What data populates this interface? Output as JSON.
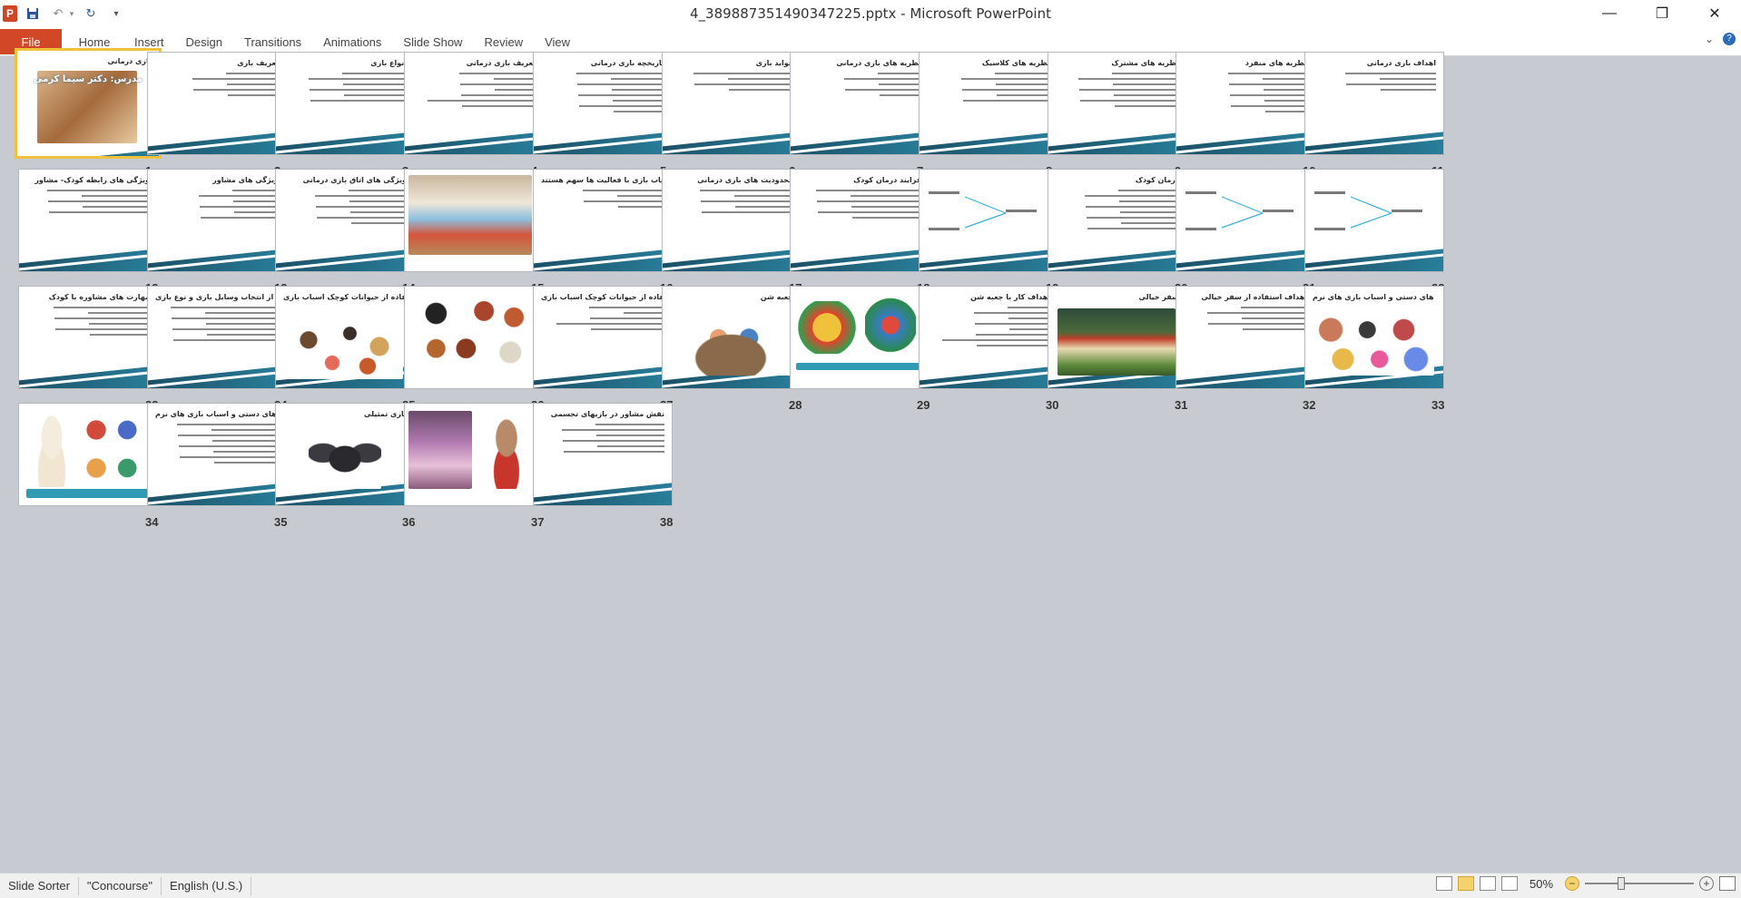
{
  "window": {
    "title": "4_389887351490347225.pptx  -  Microsoft PowerPoint",
    "app_icon_letter": "P",
    "controls": {
      "minimize": "—",
      "restore": "❐",
      "close": "✕"
    }
  },
  "quick_access": {
    "save_icon": "save-icon",
    "undo_icon": "undo-icon",
    "redo_icon": "redo-icon"
  },
  "ribbon": {
    "file_tab": "File",
    "tabs": [
      "Home",
      "Insert",
      "Design",
      "Transitions",
      "Animations",
      "Slide Show",
      "Review",
      "View"
    ]
  },
  "slides": [
    {
      "n": "1",
      "title": "بازی درمانی",
      "kind": "photo-title",
      "selected": true,
      "subtitle": "مدرس: دکتر سیما کرمی"
    },
    {
      "n": "2",
      "title": "تعریف بازی",
      "kind": "text"
    },
    {
      "n": "3",
      "title": "انواع بازی",
      "kind": "text"
    },
    {
      "n": "4",
      "title": "تعریف بازی درمانی",
      "kind": "text"
    },
    {
      "n": "5",
      "title": "تاریخچه بازی درمانی",
      "kind": "text"
    },
    {
      "n": "6",
      "title": "فواید بازی",
      "kind": "text"
    },
    {
      "n": "7",
      "title": "نظریه های بازی درمانی",
      "kind": "text"
    },
    {
      "n": "8",
      "title": "نظریه های کلاسیک",
      "kind": "text"
    },
    {
      "n": "9",
      "title": "نظریه های مشترک",
      "kind": "text"
    },
    {
      "n": "10",
      "title": "نظریه های منفرد",
      "kind": "text"
    },
    {
      "n": "11",
      "title": "اهداف بازی درمانی",
      "kind": "text"
    },
    {
      "n": "12",
      "title": "ویژگی های رابطه کودک- مشاور",
      "kind": "text"
    },
    {
      "n": "13",
      "title": "ویژگی های مشاور",
      "kind": "text"
    },
    {
      "n": "14",
      "title": "ویژگی های اتاق بازی درمانی",
      "kind": "text"
    },
    {
      "n": "15",
      "title": "",
      "kind": "photo-room"
    },
    {
      "n": "16",
      "title": "عواملی که در انتخاب وسایل اسباب بازی با فعالیت ها سهم هستند",
      "kind": "text"
    },
    {
      "n": "17",
      "title": "محدودیت های بازی درمانی",
      "kind": "text"
    },
    {
      "n": "18",
      "title": "فرایند درمان کودک",
      "kind": "text"
    },
    {
      "n": "19",
      "title": "",
      "kind": "diagram"
    },
    {
      "n": "20",
      "title": "درمان کودک",
      "kind": "text"
    },
    {
      "n": "21",
      "title": "",
      "kind": "diagram"
    },
    {
      "n": "22",
      "title": "",
      "kind": "diagram"
    },
    {
      "n": "23",
      "title": "مهارت های مشاوره با کودک",
      "kind": "text"
    },
    {
      "n": "24",
      "title": "هدف درمانگر از انتخاب وسایل بازی و نوع بازی",
      "kind": "text"
    },
    {
      "n": "25",
      "title": "استفاده از حیوانات کوچک اسباب بازی",
      "kind": "photo-animals"
    },
    {
      "n": "26",
      "title": "",
      "kind": "photo-farm"
    },
    {
      "n": "27",
      "title": "اهداف استفاده از حیوانات کوچک اسباب بازی",
      "kind": "text"
    },
    {
      "n": "28",
      "title": "جعبه شن",
      "kind": "photo-sandbox"
    },
    {
      "n": "29",
      "title": "",
      "kind": "photo-pools"
    },
    {
      "n": "30",
      "title": "اهداف کار با جعبه شن",
      "kind": "text"
    },
    {
      "n": "31",
      "title": "سفر خیالی",
      "kind": "photo-house"
    },
    {
      "n": "32",
      "title": "اهداف استفاده از سفر خیالی",
      "kind": "text"
    },
    {
      "n": "33",
      "title": "عروسک های دستی و اسباب بازی های نرم",
      "kind": "photo-puppets"
    },
    {
      "n": "34",
      "title": "",
      "kind": "photo-dolls"
    },
    {
      "n": "35",
      "title": "اهداف لازم هنگام استفاده از عروسک های دستی و اسباب بازی های نرم",
      "kind": "text"
    },
    {
      "n": "36",
      "title": "بازی تمثیلی",
      "kind": "photo-bat"
    },
    {
      "n": "37",
      "title": "",
      "kind": "photo-costume"
    },
    {
      "n": "38",
      "title": "نقش مشاور در بازیهای تجسمی",
      "kind": "text"
    }
  ],
  "statusbar": {
    "view": "Slide Sorter",
    "theme": "\"Concourse\"",
    "language": "English (U.S.)",
    "zoom": "50%"
  },
  "colors": {
    "file_tab": "#d24726",
    "selection": "#f0c23b",
    "swoosh": "#1a4d63",
    "workspace": "#c7cbd1"
  }
}
